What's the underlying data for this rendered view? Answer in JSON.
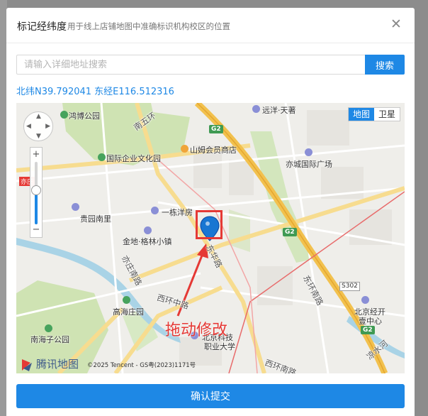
{
  "dialog": {
    "title": "标记经纬度",
    "subtitle": "用于线上店铺地图中准确标识机构校区的位置",
    "close_glyph": "✕"
  },
  "search": {
    "placeholder": "请输入详细地址搜索",
    "value": "",
    "button_label": "搜索"
  },
  "coordinates_text": "北纬N39.792041 东经E116.512316",
  "map": {
    "type_toggle": {
      "map_label": "地图",
      "satellite_label": "卫星",
      "selected": "地图"
    },
    "pois": [
      "鸿博公园",
      "南五环",
      "远洋·天著",
      "山姆会员商店",
      "国际企业文化园",
      "亦城国际广场",
      "贵园南里",
      "一栋洋房",
      "金地·格林小镇",
      "东华路",
      "东环南路",
      "亦庄南路",
      "西环中路",
      "高海庄园",
      "北京经开",
      "壹中心",
      "南海子公园",
      "北京科技",
      "职业大学",
      "西环南路",
      "凉水河",
      "亦庄"
    ],
    "route_shields": [
      "G2",
      "G2",
      "G2",
      "S302"
    ],
    "annotation": "拖动修改",
    "provider_logo": "腾讯地图",
    "copyright": "©2025 Tencent - GS粤(2023)1171号",
    "zoom_level_fraction": 0.55
  },
  "footer": {
    "confirm_label": "确认提交"
  },
  "colors": {
    "primary": "#1e88e5",
    "highlight": "#e53935",
    "expressway": "#f2c14e",
    "park": "#cfe3b3",
    "water": "#a9d3e6"
  },
  "icons": {
    "close": "close-icon",
    "marker": "location-pin-icon",
    "nav": "pan-control-icon",
    "arrow": "arrow-icon"
  }
}
